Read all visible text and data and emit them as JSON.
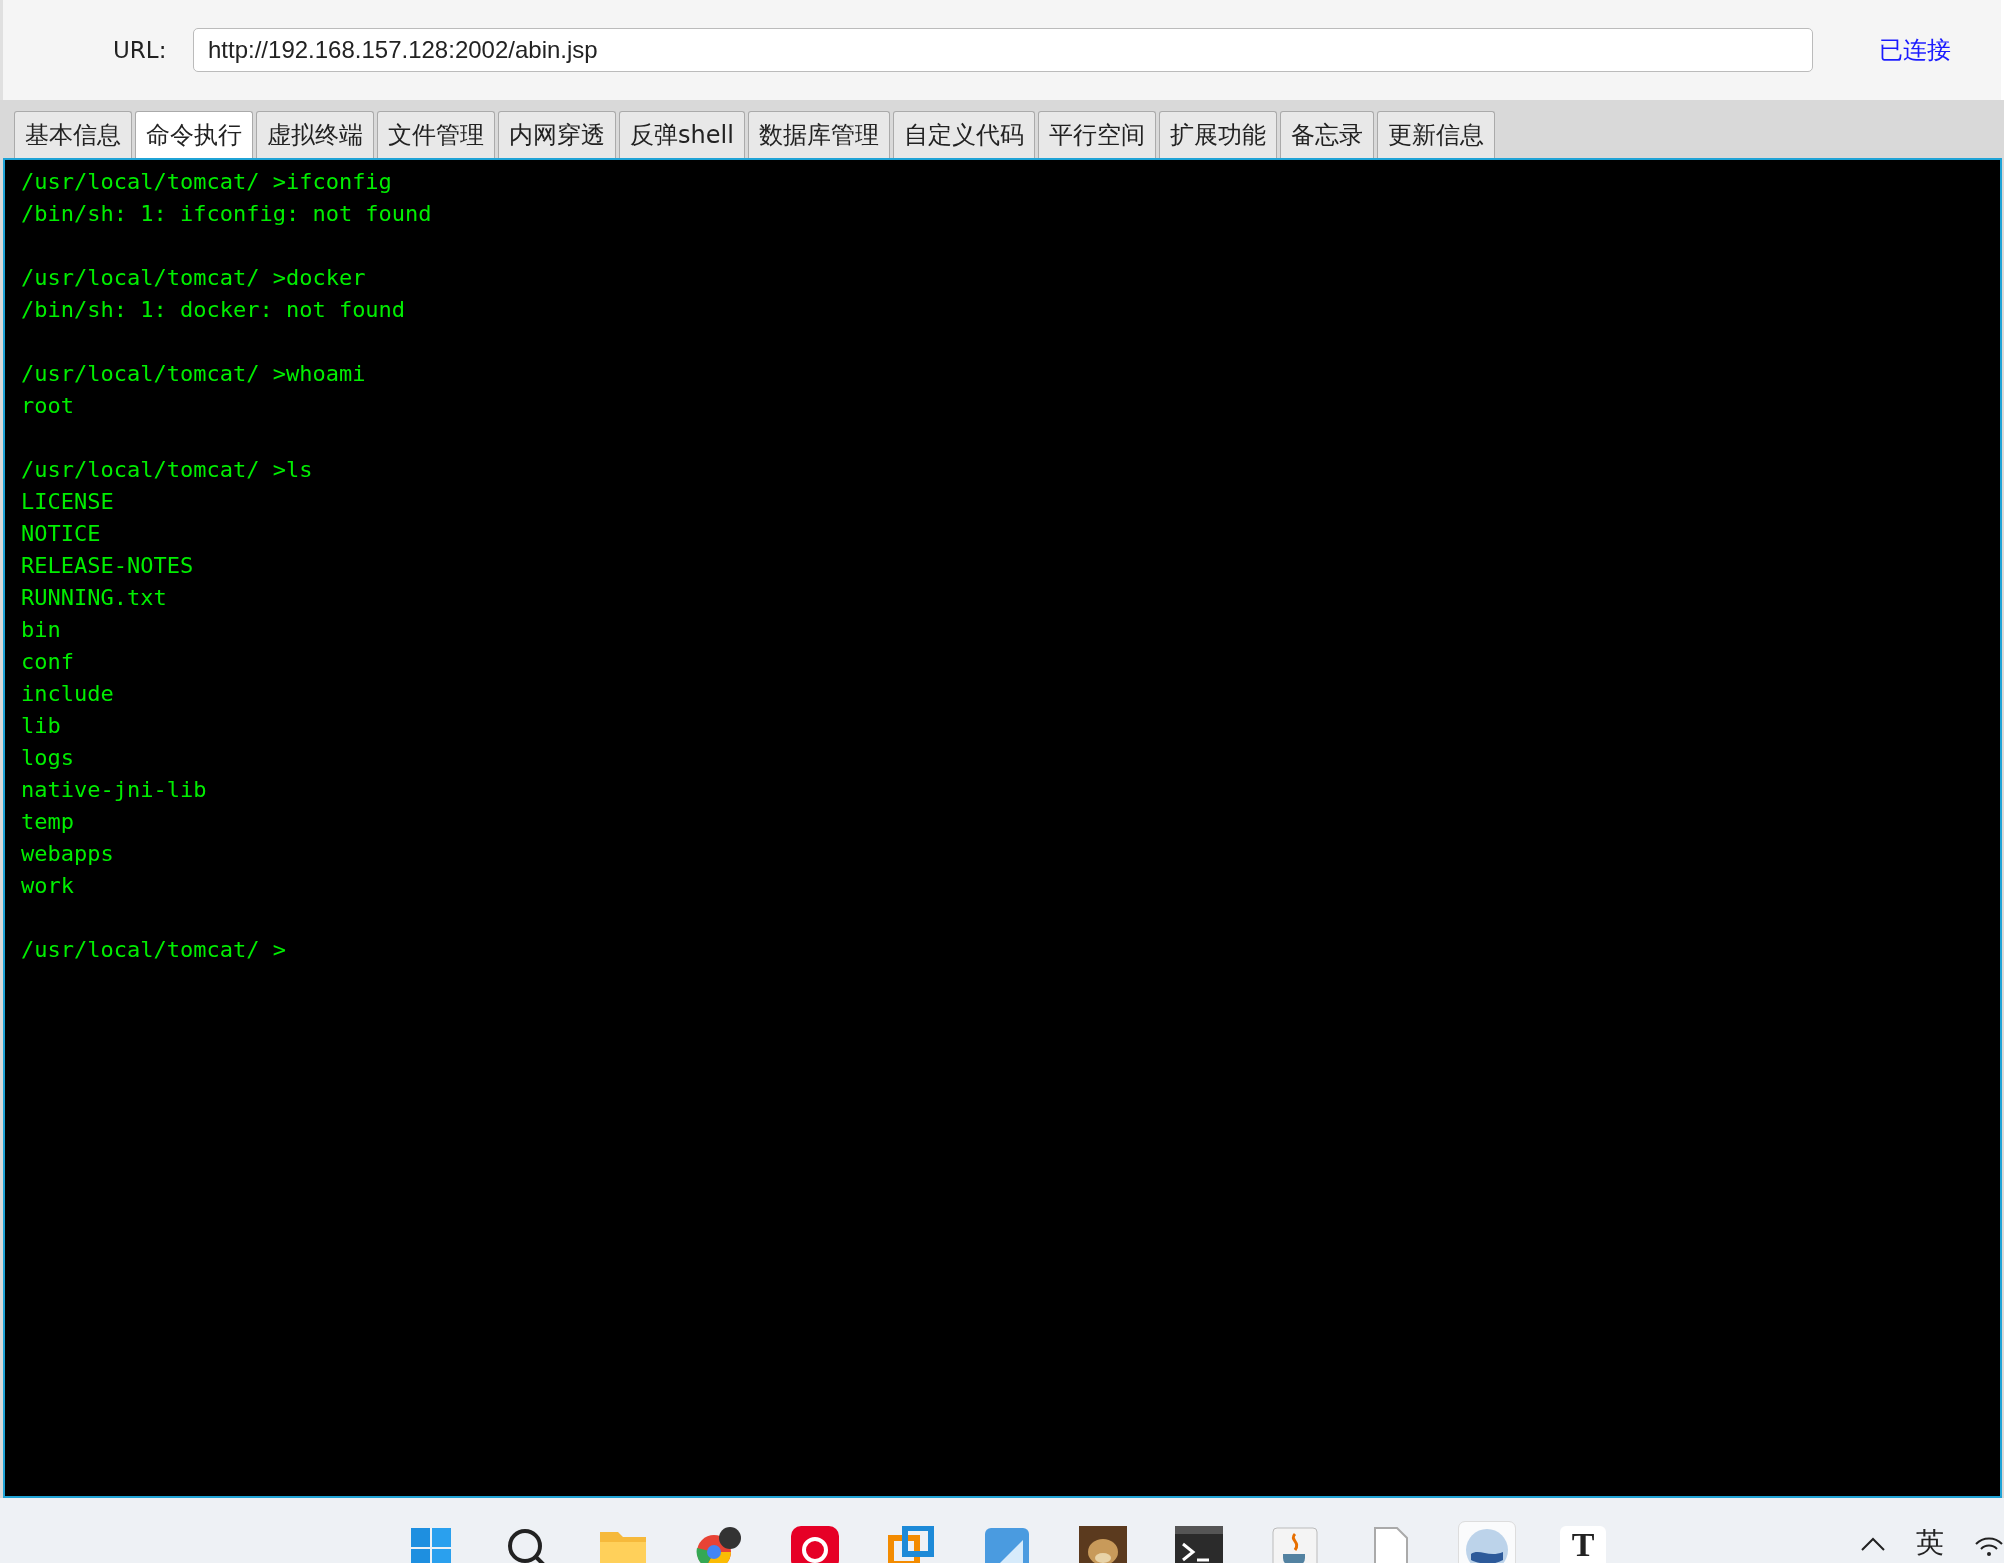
{
  "url_bar": {
    "label": "URL:",
    "value": "http://192.168.157.128:2002/abin.jsp",
    "status": "已连接"
  },
  "tabs": [
    {
      "label": "基本信息",
      "selected": false
    },
    {
      "label": "命令执行",
      "selected": true
    },
    {
      "label": "虚拟终端",
      "selected": false
    },
    {
      "label": "文件管理",
      "selected": false
    },
    {
      "label": "内网穿透",
      "selected": false
    },
    {
      "label": "反弹shell",
      "selected": false
    },
    {
      "label": "数据库管理",
      "selected": false
    },
    {
      "label": "自定义代码",
      "selected": false
    },
    {
      "label": "平行空间",
      "selected": false
    },
    {
      "label": "扩展功能",
      "selected": false
    },
    {
      "label": "备忘录",
      "selected": false
    },
    {
      "label": "更新信息",
      "selected": false
    }
  ],
  "terminal": {
    "blocks": [
      [
        "/usr/local/tomcat/ >ifconfig",
        "/bin/sh: 1: ifconfig: not found"
      ],
      [
        "/usr/local/tomcat/ >docker",
        "/bin/sh: 1: docker: not found"
      ],
      [
        "/usr/local/tomcat/ >whoami",
        "root"
      ],
      [
        "/usr/local/tomcat/ >ls",
        "LICENSE",
        "NOTICE",
        "RELEASE-NOTES",
        "RUNNING.txt",
        "bin",
        "conf",
        "include",
        "lib",
        "logs",
        "native-jni-lib",
        "temp",
        "webapps",
        "work"
      ],
      [
        "/usr/local/tomcat/ >"
      ]
    ]
  },
  "taskbar": {
    "icons": [
      {
        "kind": "windows",
        "selected": false
      },
      {
        "kind": "search",
        "selected": false
      },
      {
        "kind": "folder",
        "selected": false
      },
      {
        "kind": "browser",
        "selected": false
      },
      {
        "kind": "music",
        "selected": false
      },
      {
        "kind": "vm",
        "selected": false
      },
      {
        "kind": "app",
        "selected": false
      },
      {
        "kind": "animal",
        "selected": false
      },
      {
        "kind": "terminal",
        "selected": false
      },
      {
        "kind": "java",
        "selected": false
      },
      {
        "kind": "file",
        "selected": false
      },
      {
        "kind": "globe",
        "selected": true
      },
      {
        "kind": "letter",
        "label": "T",
        "selected": false
      }
    ],
    "input_method": "英"
  }
}
